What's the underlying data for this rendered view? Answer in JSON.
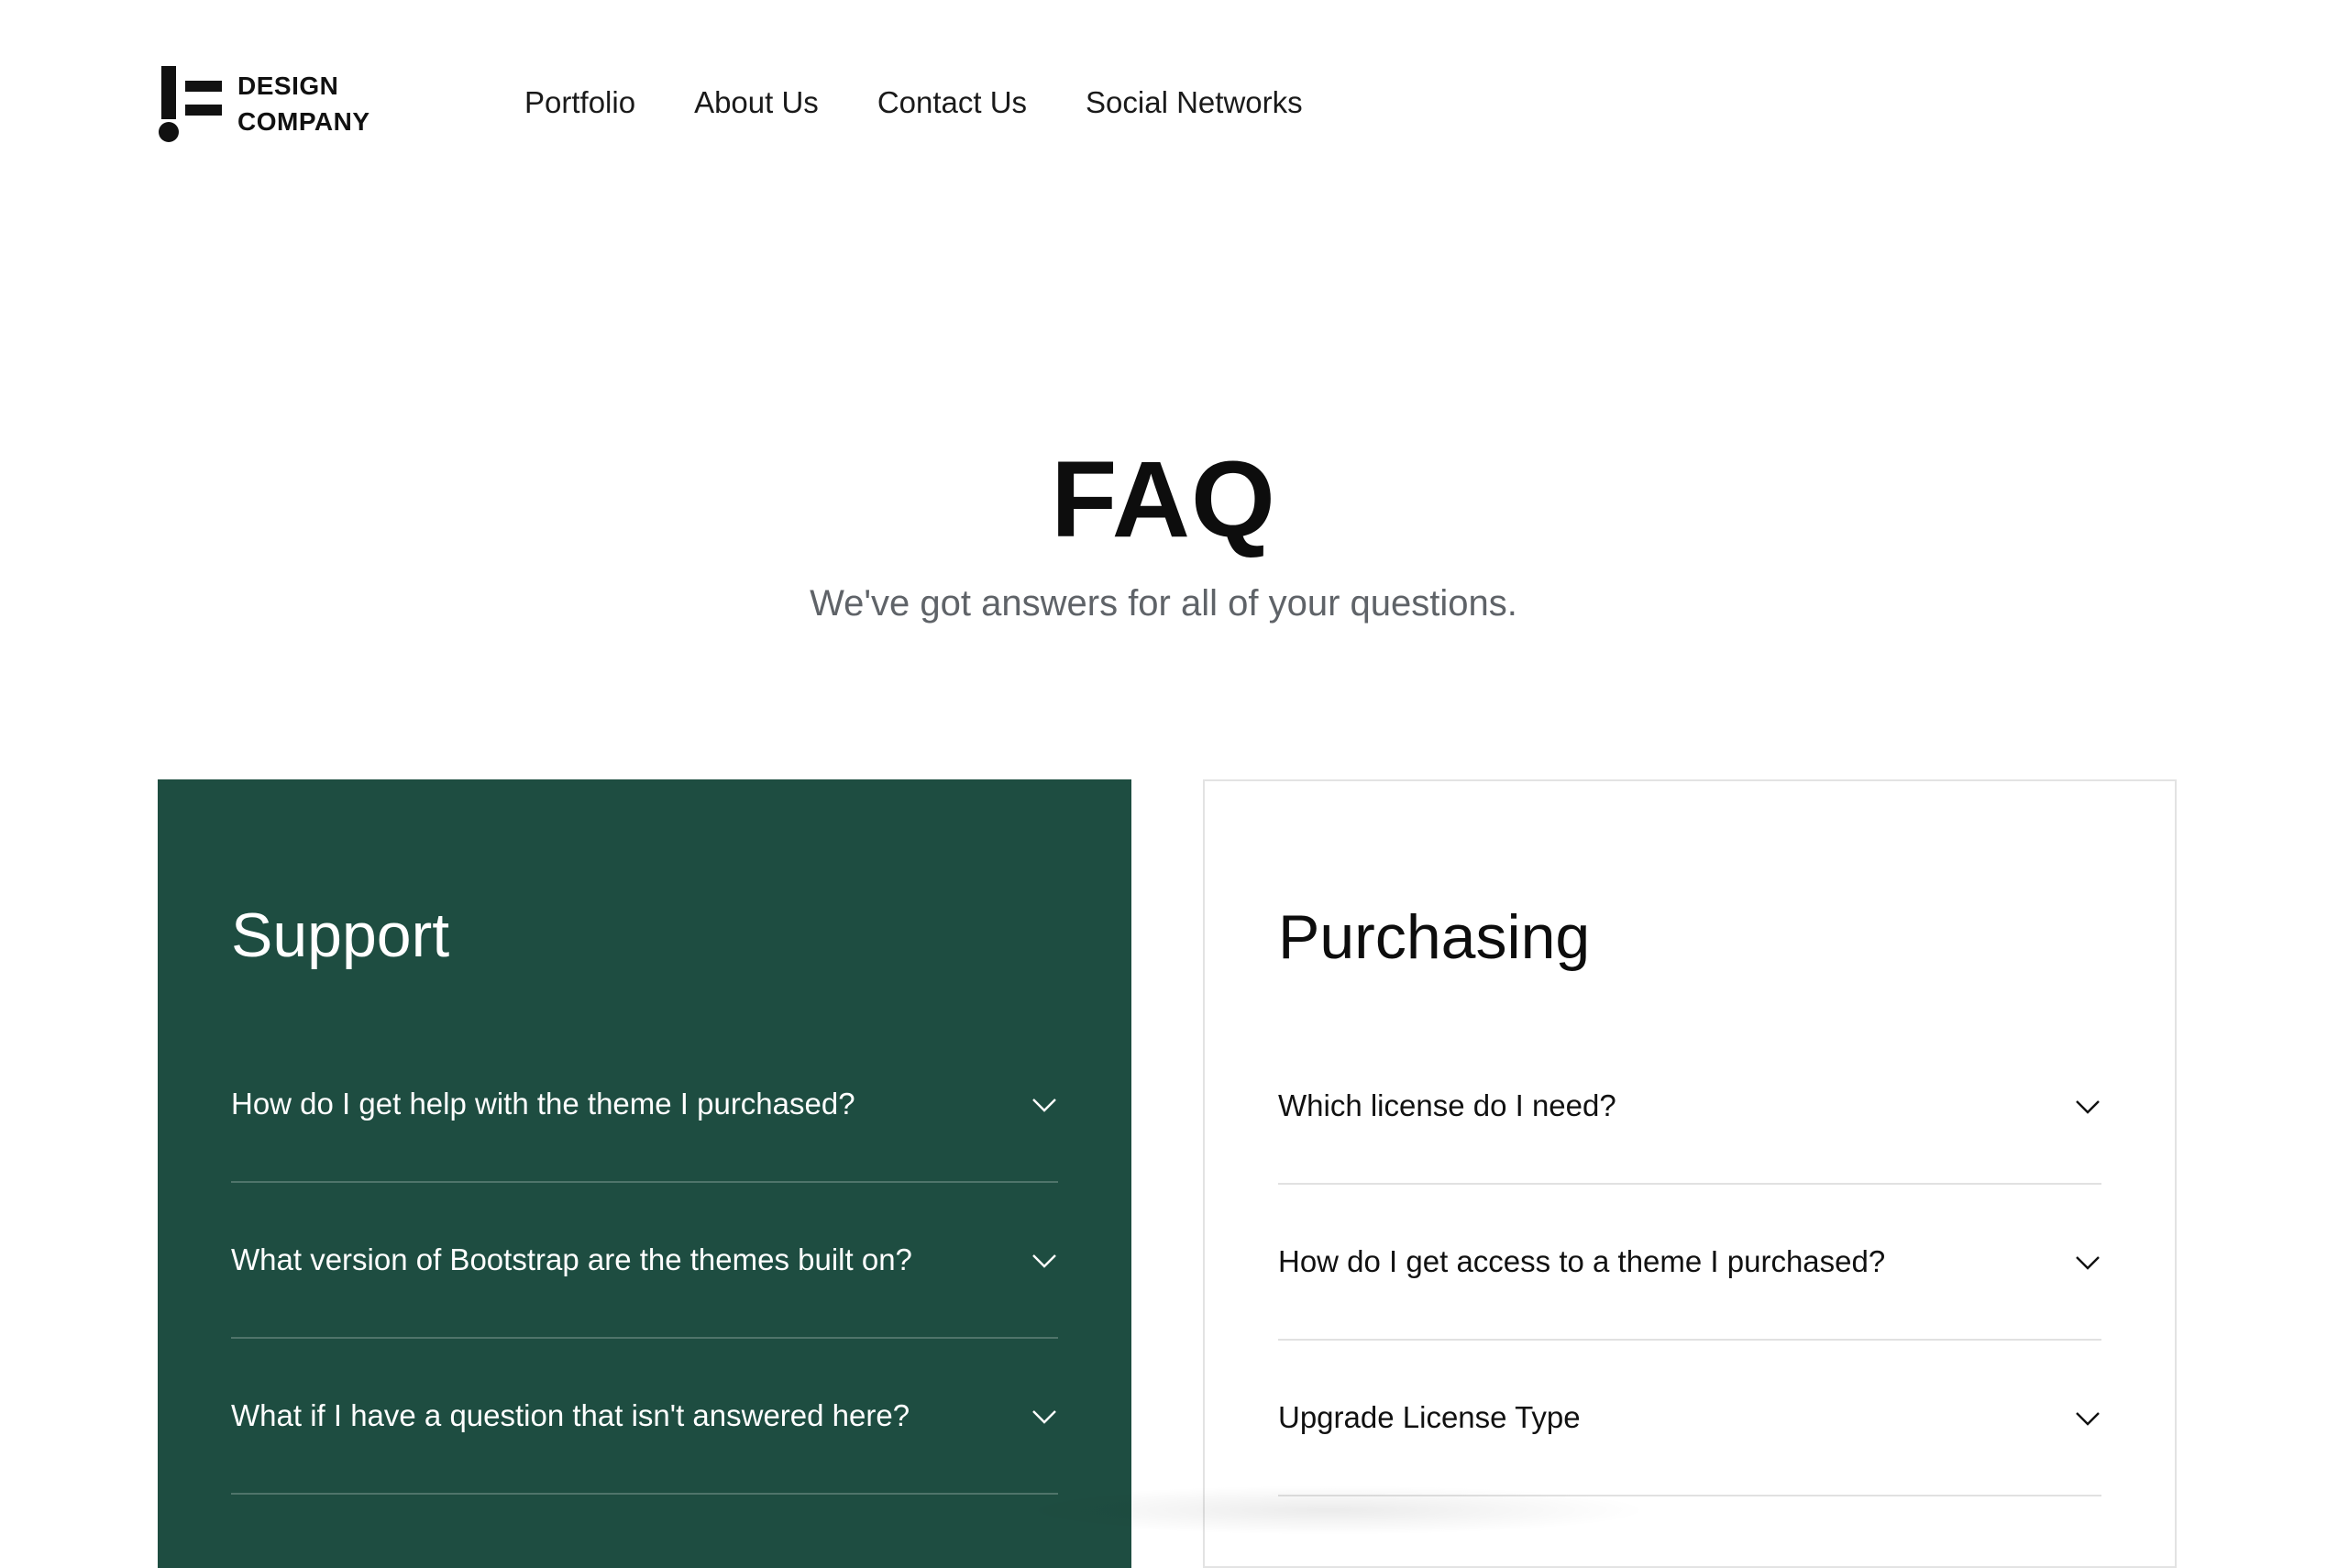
{
  "brand": {
    "line1": "DESIGN",
    "line2": "COMPANY",
    "icon": "exclamation-lines-logo"
  },
  "nav": {
    "items": [
      {
        "label": "Portfolio"
      },
      {
        "label": "About Us"
      },
      {
        "label": "Contact Us"
      },
      {
        "label": "Social Networks"
      }
    ]
  },
  "hero": {
    "title": "FAQ",
    "subtitle": "We've got answers for all of your questions."
  },
  "support": {
    "title": "Support",
    "background": "#1e4d41",
    "questions": [
      {
        "q": "How do I get help with the theme I purchased?",
        "icon": "chevron-down-icon"
      },
      {
        "q": "What version of Bootstrap are the themes built on?",
        "icon": "chevron-down-icon"
      },
      {
        "q": "What if I have a question that isn't answered here?",
        "icon": "chevron-down-icon"
      }
    ]
  },
  "purchasing": {
    "title": "Purchasing",
    "questions": [
      {
        "q": "Which license do I need?",
        "icon": "chevron-down-icon"
      },
      {
        "q": "How do I get access to a theme I purchased?",
        "icon": "chevron-down-icon"
      },
      {
        "q": "Upgrade License Type",
        "icon": "chevron-down-icon"
      }
    ]
  }
}
